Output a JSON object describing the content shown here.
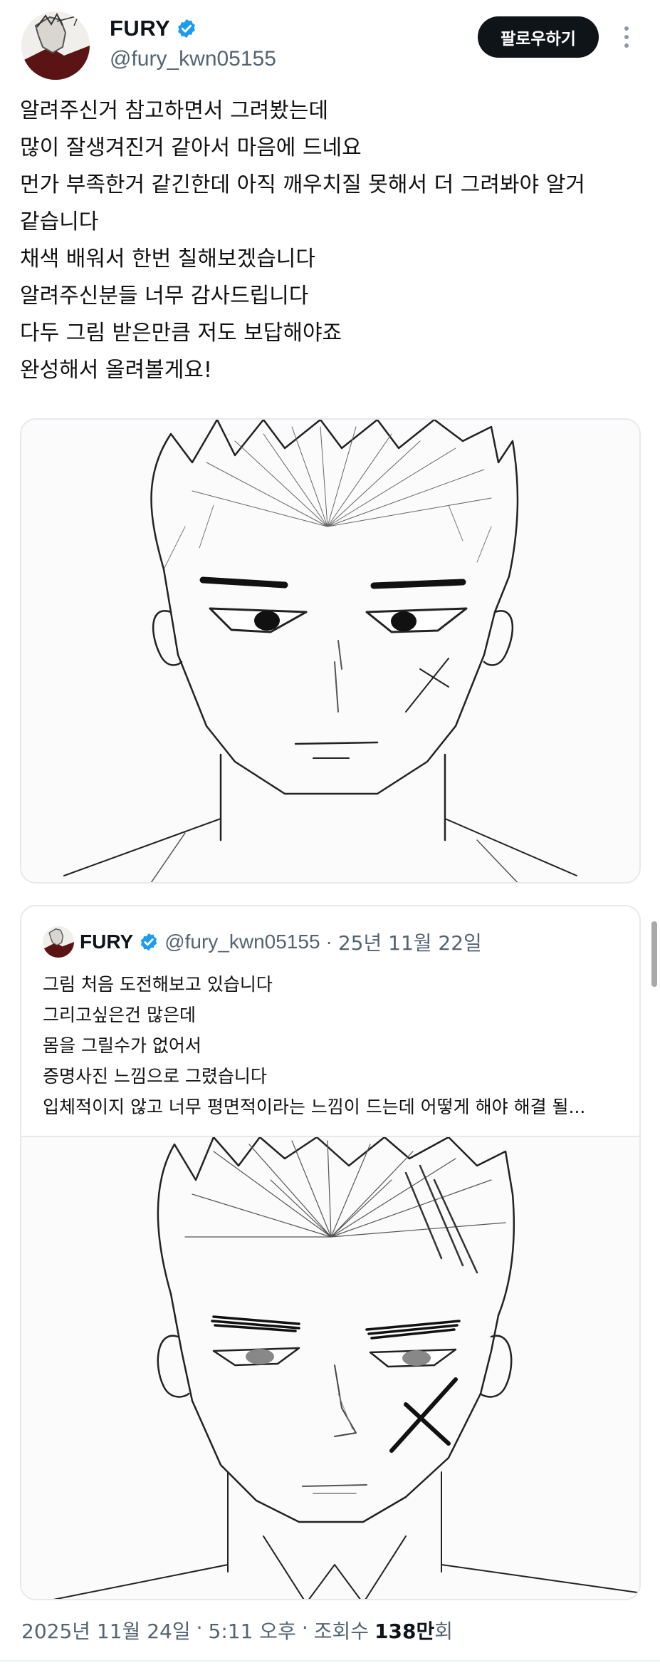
{
  "author": {
    "name": "FURY",
    "handle": "@fury_kwn05155",
    "verified": true,
    "avatar_icon": "avatar-sketch-icon"
  },
  "header": {
    "follow_label": "팔로우하기",
    "more_icon": "more-vertical-icon"
  },
  "tweet": {
    "lines": [
      "알려주신거 참고하면서 그려봤는데",
      "많이 잘생겨진거 같아서 마음에 드네요",
      "먼가 부족한거 같긴한데 아직 깨우치질 못해서 더 그려봐야 알거",
      "같습니다",
      "채색 배워서 한번 칠해보겠습니다",
      "알려주신분들 너무 감사드립니다",
      "다두 그림 받은만큼 저도 보답해야죠",
      "완성해서 올려볼게요!"
    ]
  },
  "quote": {
    "name": "FURY",
    "handle": "@fury_kwn05155",
    "separator": "·",
    "date": "25년 11월 22일",
    "lines": [
      "그림 처음 도전해보고 있습니다",
      "그리고싶은건 많은데",
      "몸을 그릴수가 없어서",
      "증명사진 느낌으로 그렸습니다",
      "입체적이지 않고 너무 평면적이라는 느낌이 드는데 어떻게 해야 해결 될..."
    ]
  },
  "footer": {
    "date": "2025년 11월 24일",
    "separator": "·",
    "time": "5:11 오후",
    "views_label": "조회수",
    "views_count": "138만",
    "views_unit": "회"
  },
  "colors": {
    "text": "#0f1419",
    "secondary": "#536471",
    "verified": "#1d9bf0",
    "border": "#e6e9ec"
  }
}
